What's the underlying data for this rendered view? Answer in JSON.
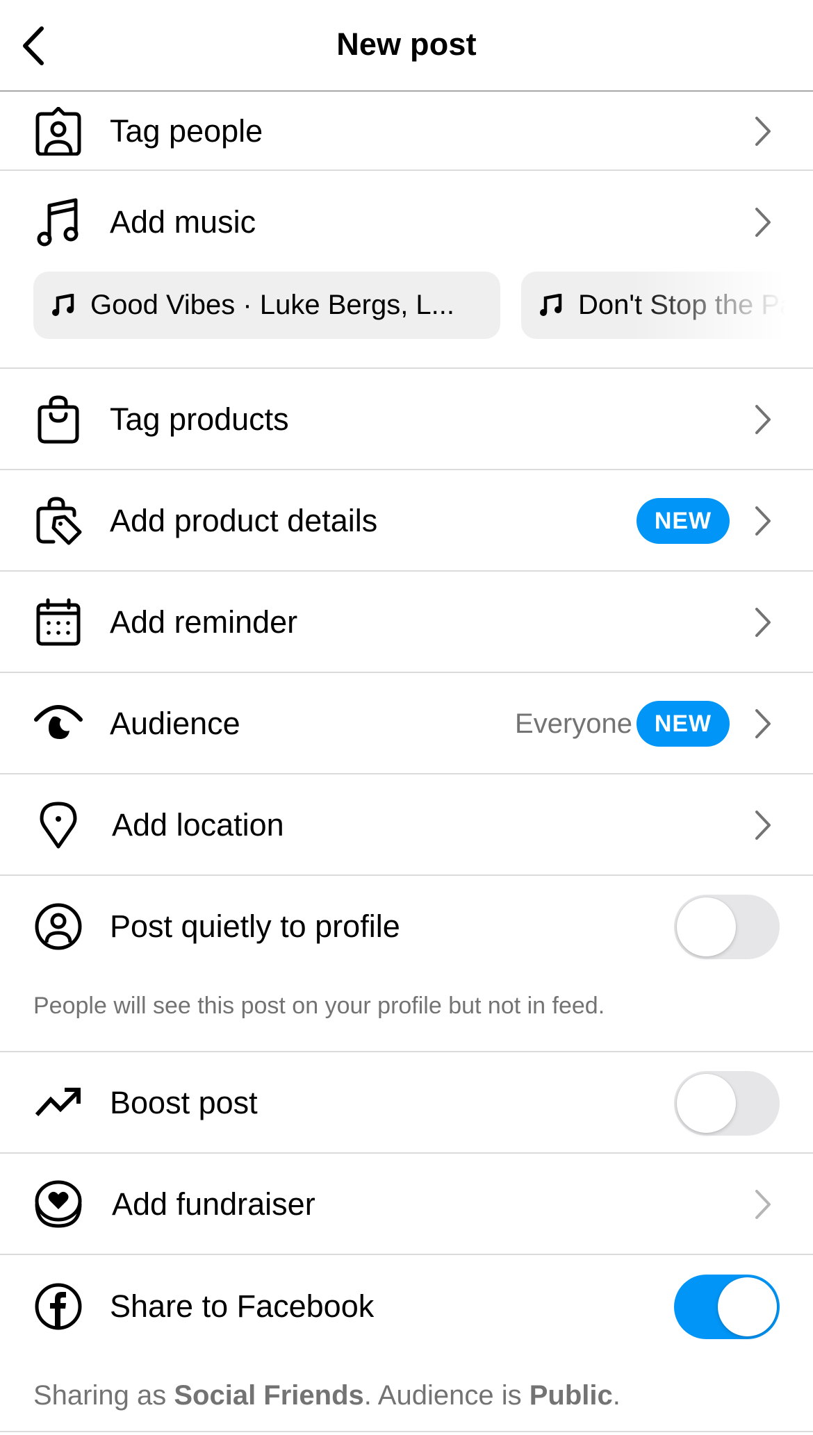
{
  "header": {
    "title": "New post",
    "back_icon": "chevron-left-icon"
  },
  "rows": {
    "tag_people": {
      "label": "Tag people",
      "icon": "tag-person-icon"
    },
    "add_music": {
      "label": "Add music",
      "icon": "music-note-icon",
      "suggestions": [
        {
          "text": "Good Vibes · Luke Bergs, L...",
          "icon": "music-note-icon"
        },
        {
          "text": "Don't Stop the Pa",
          "icon": "music-note-icon"
        }
      ]
    },
    "tag_products": {
      "label": "Tag products",
      "icon": "shopping-bag-icon"
    },
    "add_product_details": {
      "label": "Add product details",
      "icon": "bag-tag-icon",
      "badge": "NEW"
    },
    "add_reminder": {
      "label": "Add reminder",
      "icon": "calendar-icon"
    },
    "audience": {
      "label": "Audience",
      "icon": "eye-icon",
      "value": "Everyone",
      "badge": "NEW"
    },
    "add_location": {
      "label": "Add location",
      "icon": "location-pin-icon"
    },
    "post_quietly": {
      "label": "Post quietly to profile",
      "icon": "profile-circle-icon",
      "enabled": false,
      "helper": "People will see this post on your profile but not in feed."
    },
    "boost_post": {
      "label": "Boost post",
      "icon": "trending-up-icon",
      "enabled": false
    },
    "add_fundraiser": {
      "label": "Add fundraiser",
      "icon": "fundraiser-heart-icon"
    },
    "share_facebook": {
      "label": "Share to Facebook",
      "icon": "facebook-icon",
      "enabled": true,
      "helper_prefix": "Sharing as ",
      "helper_account": "Social Friends",
      "helper_middle": ". Audience is ",
      "helper_audience": "Public",
      "helper_suffix": "."
    }
  },
  "colors": {
    "accent": "#0095f6",
    "secondary_text": "#737373",
    "divider": "#dbdbdb",
    "chip_bg": "#efefef",
    "toggle_off": "#e6e6e8"
  }
}
